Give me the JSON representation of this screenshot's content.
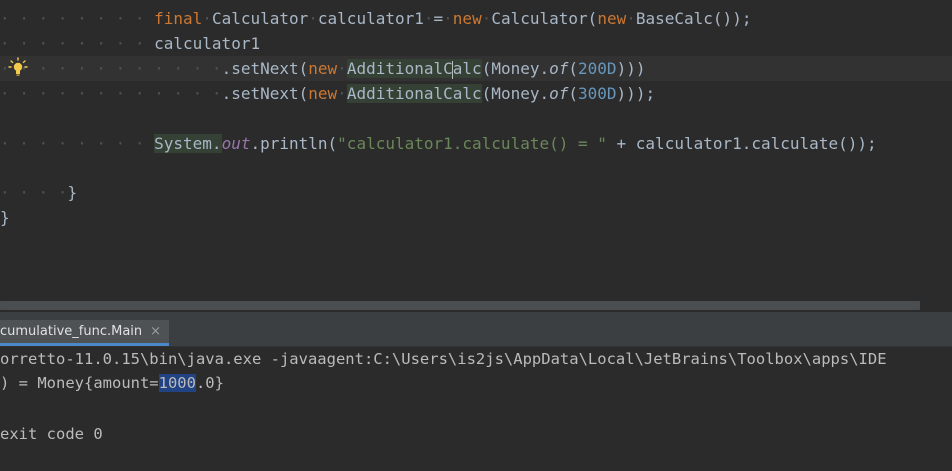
{
  "editor": {
    "line1": {
      "kw_final": "final",
      "type": "Calculator",
      "var": "calculator1",
      "eq": "=",
      "kw_new": "new",
      "ctor": "Calculator(",
      "kw_new2": "new",
      "inner": "BaseCalc());"
    },
    "line2": {
      "text": "calculator1"
    },
    "line3": {
      "method": ".setNext(",
      "kw_new": "new",
      "cls_a": "AdditionalC",
      "cls_b": "alc",
      "money": "(Money.",
      "of": "of",
      "paren": "(",
      "num": "200D",
      "close": ")))"
    },
    "line4": {
      "method": ".setNext(",
      "kw_new": "new",
      "cls": "AdditionalCalc",
      "money": "(Money.",
      "of": "of",
      "paren": "(",
      "num": "300D",
      "close": ")));"
    },
    "line5": {
      "system": "System.",
      "out": "out",
      "println": ".println(",
      "string": "\"calculator1.calculate() = \"",
      "plus": " + calculator1.calculate());"
    },
    "brace1": "}",
    "brace2": "}"
  },
  "run_panel": {
    "tab_label": "cumulative_func.Main",
    "close_symbol": "×",
    "console": {
      "line1": "orretto-11.0.15\\bin\\java.exe -javaagent:C:\\Users\\is2js\\AppData\\Local\\JetBrains\\Toolbox\\apps\\IDE",
      "line2_pre": ") = Money{amount=",
      "line2_sel": "1000",
      "line2_post": ".0}",
      "line3": "exit code 0"
    }
  },
  "icons": {
    "bulb": "lightbulb-icon"
  }
}
